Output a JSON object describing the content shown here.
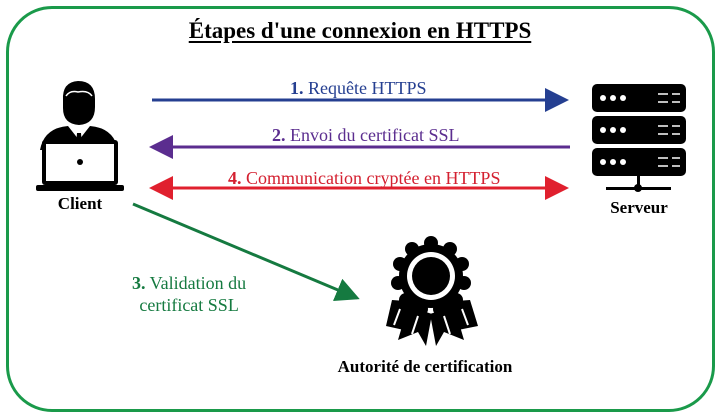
{
  "title": "Étapes d'une connexion en HTTPS",
  "nodes": {
    "client": "Client",
    "server": "Serveur",
    "ca": "Autorité de certification"
  },
  "steps": [
    {
      "num": "1.",
      "text": " Requête HTTPS",
      "color": "#253f91"
    },
    {
      "num": "2.",
      "text": " Envoi du certificat SSL",
      "color": "#5b2d8f"
    },
    {
      "num": "4.",
      "text": " Communication cryptée en HTTPS",
      "color": "#d42030"
    },
    {
      "num": "3.",
      "line1": " Validation du",
      "line2": "certificat SSL",
      "color": "#157a40"
    }
  ],
  "icons": {
    "client": "user-laptop-icon",
    "server": "server-rack-icon",
    "ca": "certificate-seal-icon"
  }
}
